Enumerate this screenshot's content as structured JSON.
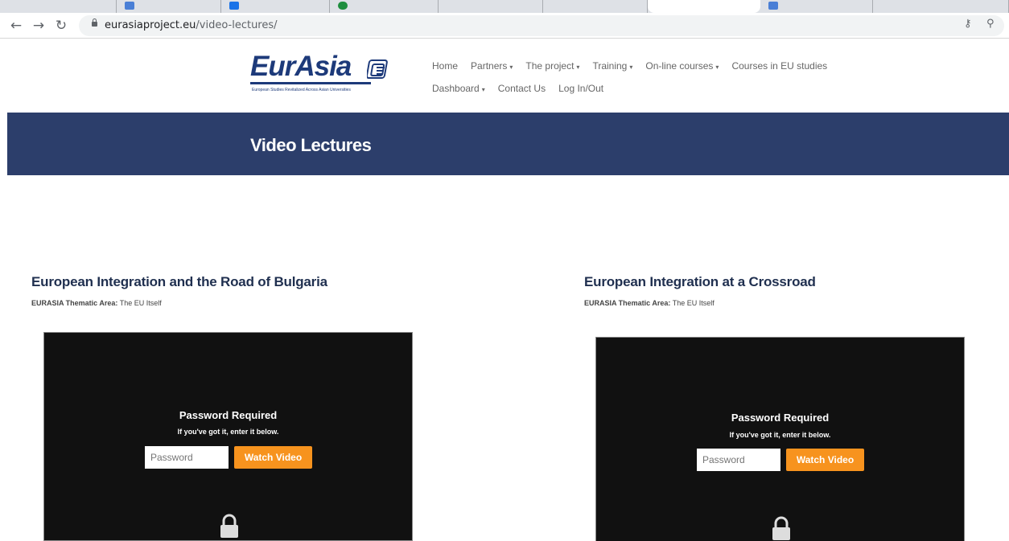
{
  "browser": {
    "url_host": "eurasiaproject.eu",
    "url_path": "/video-lectures/"
  },
  "site": {
    "logo_text": "EurAsia",
    "logo_tagline": "European Studies Revitalized Across Asian Universities",
    "menu_row1": [
      {
        "label": "Home",
        "dropdown": false
      },
      {
        "label": "Partners",
        "dropdown": true
      },
      {
        "label": "The project",
        "dropdown": true
      },
      {
        "label": "Training",
        "dropdown": true
      },
      {
        "label": "On-line courses",
        "dropdown": true
      },
      {
        "label": "Courses in EU studies",
        "dropdown": false
      }
    ],
    "menu_row2": [
      {
        "label": "Dashboard",
        "dropdown": true
      },
      {
        "label": "Contact Us",
        "dropdown": false
      },
      {
        "label": "Log In/Out",
        "dropdown": false
      }
    ]
  },
  "page": {
    "title": "Video Lectures"
  },
  "videos": [
    {
      "title": "European Integration and the Road of Bulgaria",
      "area_label": "EURASIA Thematic Area:",
      "area_value": "The EU Itself",
      "player": {
        "heading": "Password Required",
        "hint": "If you've got it, enter it below.",
        "placeholder": "Password",
        "button": "Watch Video"
      }
    },
    {
      "title": "European Integration at a Crossroad",
      "area_label": "EURASIA Thematic Area:",
      "area_value": "The EU Itself",
      "player": {
        "heading": "Password Required",
        "hint": "If you've got it, enter it below.",
        "placeholder": "Password",
        "button": "Watch Video"
      }
    }
  ],
  "colors": {
    "banner": "#2c3e6b",
    "brand": "#1d3a7a",
    "watch_button": "#f7931e"
  }
}
